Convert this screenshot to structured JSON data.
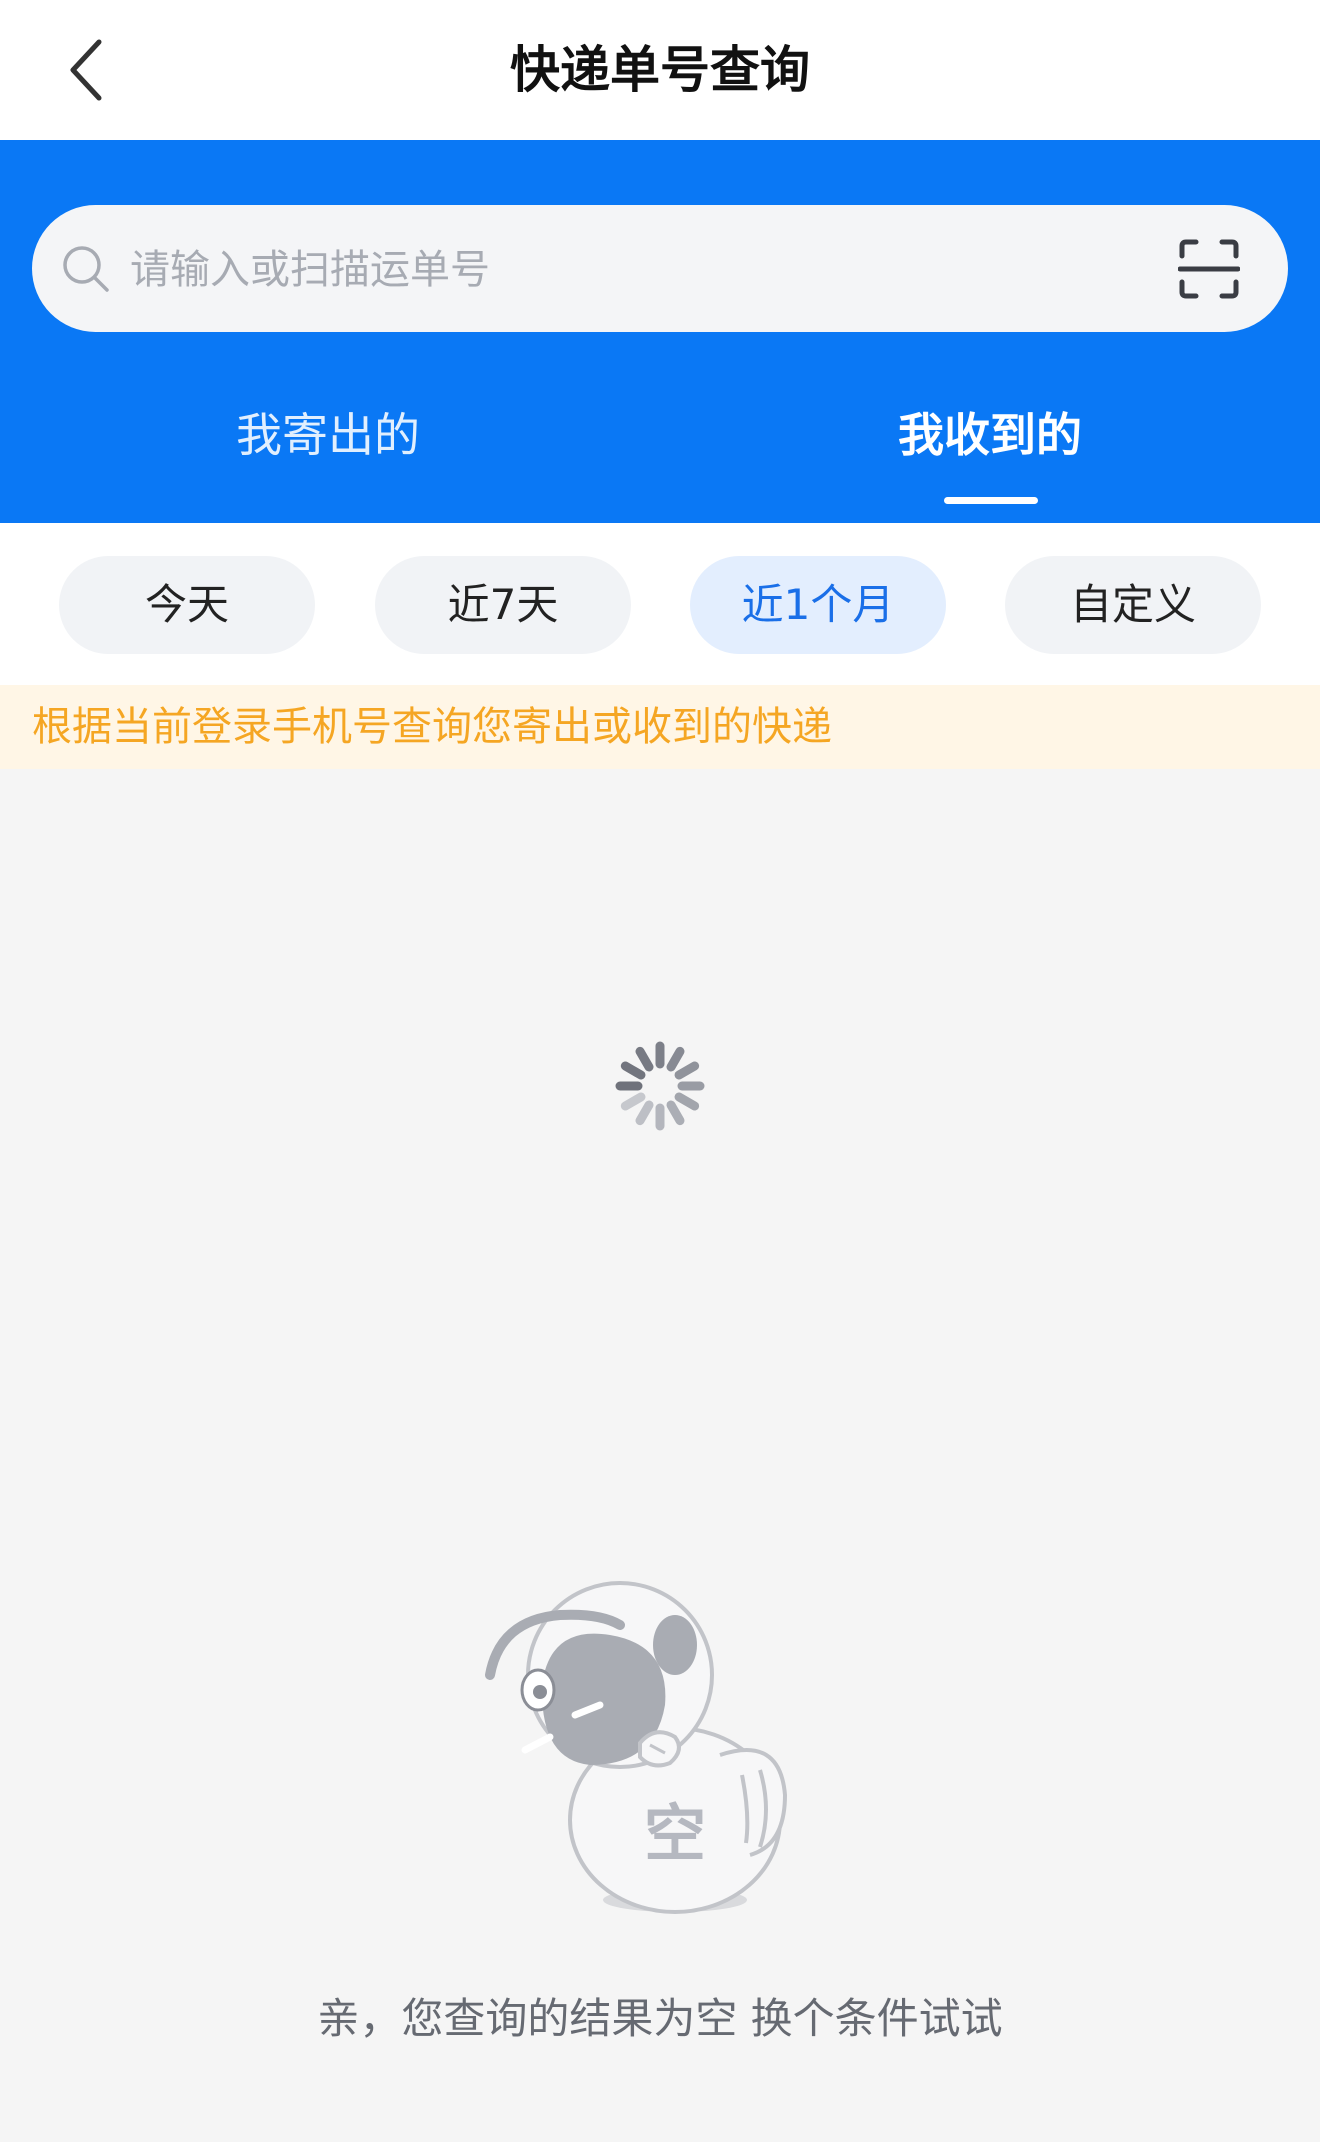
{
  "header": {
    "title": "快递单号查询"
  },
  "search": {
    "placeholder": "请输入或扫描运单号",
    "value": ""
  },
  "tabs": [
    {
      "label": "我寄出的",
      "active": false
    },
    {
      "label": "我收到的",
      "active": true
    }
  ],
  "filters": [
    {
      "label": "今天",
      "active": false
    },
    {
      "label": "近7天",
      "active": false
    },
    {
      "label": "近1个月",
      "active": true
    },
    {
      "label": "自定义",
      "active": false
    }
  ],
  "notice": {
    "text": "根据当前登录手机号查询您寄出或收到的快递"
  },
  "empty": {
    "glyph": "空",
    "message": "亲，您查询的结果为空 换个条件试试"
  },
  "icons": {
    "back": "back-arrow-icon",
    "search": "search-icon",
    "scan": "scan-icon",
    "loading": "loading-spinner-icon"
  },
  "colors": {
    "brand_blue": "#0a78f5",
    "notice_text": "#f5a623",
    "notice_bg": "#fff6e6",
    "chip_active_text": "#1a6fe8",
    "chip_active_bg": "#e3eefe"
  }
}
